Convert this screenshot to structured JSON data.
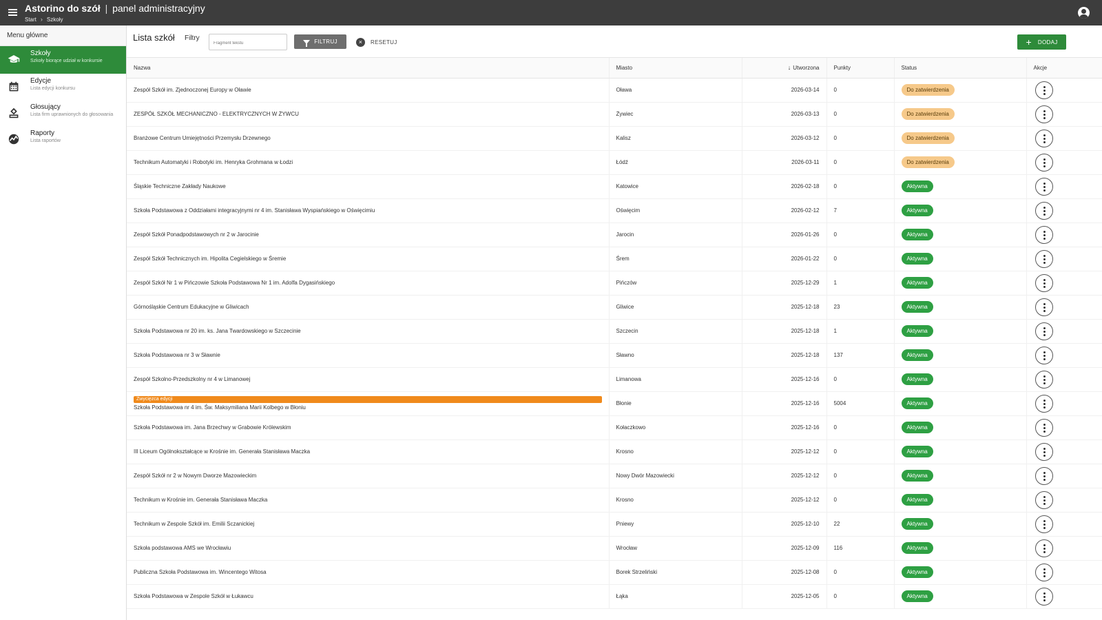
{
  "header": {
    "app_name": "Astorino do szół",
    "separator": "|",
    "app_subtitle": "panel administracyjny",
    "breadcrumb": [
      "Start",
      "Szkoły"
    ],
    "menu_icon": "hamburger-icon",
    "user_icon": "account-circle-icon"
  },
  "sidebar": {
    "title": "Menu główne",
    "items": [
      {
        "label": "Szkoły",
        "sub": "Szkoły biorące udział w konkursie",
        "icon": "school-icon",
        "active": true
      },
      {
        "label": "Edycje",
        "sub": "Lista edycji konkursu",
        "icon": "calendar-icon",
        "active": false
      },
      {
        "label": "Głosujący",
        "sub": "Lista firm uprawnionych do głosowania",
        "icon": "vote-icon",
        "active": false
      },
      {
        "label": "Raporty",
        "sub": "Lista raportów",
        "icon": "report-icon",
        "active": false
      }
    ]
  },
  "toolbar": {
    "title": "Lista szkół",
    "filters_label": "Filtry",
    "search_placeholder": "Fragment tekstu",
    "filter_button": "FILTRUJ",
    "reset_button": "RESETUJ",
    "add_button": "DODAJ"
  },
  "table": {
    "columns": {
      "name": "Nazwa",
      "city": "Miasto",
      "created": "Utworzona",
      "points": "Punkty",
      "status": "Status",
      "actions": "Akcje"
    },
    "sort": {
      "column": "created",
      "direction": "desc"
    },
    "winner_badge": "Zwycięzca edycji",
    "rows": [
      {
        "name": "Zespół Szkół im. Zjednoczonej Europy w Oławie",
        "city": "Oława",
        "created": "2026-03-14",
        "points": "0",
        "status": "Do zatwierdzenia",
        "status_type": "pending"
      },
      {
        "name": "ZESPÓŁ SZKÓŁ MECHANICZNO - ELEKTRYCZNYCH W ŻYWCU",
        "city": "Żywiec",
        "created": "2026-03-13",
        "points": "0",
        "status": "Do zatwierdzenia",
        "status_type": "pending"
      },
      {
        "name": "Branżowe Centrum Umiejętności Przemysłu Drzewnego",
        "city": "Kalisz",
        "created": "2026-03-12",
        "points": "0",
        "status": "Do zatwierdzenia",
        "status_type": "pending"
      },
      {
        "name": "Technikum Automatyki i Robotyki im. Henryka Grohmana w Łodzi",
        "city": "Łódź",
        "created": "2026-03-11",
        "points": "0",
        "status": "Do zatwierdzenia",
        "status_type": "pending"
      },
      {
        "name": "Śląskie Techniczne Zakłady Naukowe",
        "city": "Katowice",
        "created": "2026-02-18",
        "points": "0",
        "status": "Aktywna",
        "status_type": "active"
      },
      {
        "name": "Szkoła Podstawowa z Oddziałami integracyjnymi nr 4 im. Stanisława Wyspiańskiego w Oświęcimiu",
        "city": "Oświęcim",
        "created": "2026-02-12",
        "points": "7",
        "status": "Aktywna",
        "status_type": "active"
      },
      {
        "name": "Zespół Szkół Ponadpodstawowych nr 2 w Jarocinie",
        "city": "Jarocin",
        "created": "2026-01-26",
        "points": "0",
        "status": "Aktywna",
        "status_type": "active"
      },
      {
        "name": "Zespół Szkół Technicznych im. Hipolita Cegielskiego w Śremie",
        "city": "Śrem",
        "created": "2026-01-22",
        "points": "0",
        "status": "Aktywna",
        "status_type": "active"
      },
      {
        "name": "Zespół Szkół Nr 1 w Pińczowie Szkoła Podstawowa Nr 1 im. Adolfa Dygasińskiego",
        "city": "Pińczów",
        "created": "2025-12-29",
        "points": "1",
        "status": "Aktywna",
        "status_type": "active"
      },
      {
        "name": "Górnośląskie Centrum Edukacyjne w Gliwicach",
        "city": "Gliwice",
        "created": "2025-12-18",
        "points": "23",
        "status": "Aktywna",
        "status_type": "active"
      },
      {
        "name": "Szkoła Podstawowa nr 20 im. ks. Jana Twardowskiego w Szczecinie",
        "city": "Szczecin",
        "created": "2025-12-18",
        "points": "1",
        "status": "Aktywna",
        "status_type": "active"
      },
      {
        "name": "Szkoła Podstawowa nr 3 w Sławnie",
        "city": "Sławno",
        "created": "2025-12-18",
        "points": "137",
        "status": "Aktywna",
        "status_type": "active"
      },
      {
        "name": "Zespół Szkolno-Przedszkolny nr 4 w Limanowej",
        "city": "Limanowa",
        "created": "2025-12-16",
        "points": "0",
        "status": "Aktywna",
        "status_type": "active"
      },
      {
        "name": "Szkoła Podstawowa nr 4 im. Św. Maksymiliana Marii Kolbego w Błoniu",
        "city": "Błonie",
        "created": "2025-12-16",
        "points": "5004",
        "status": "Aktywna",
        "status_type": "active",
        "winner": true
      },
      {
        "name": "Szkoła Podstawowa im. Jana Brzechwy w Grabowie Królewskim",
        "city": "Kołaczkowo",
        "created": "2025-12-16",
        "points": "0",
        "status": "Aktywna",
        "status_type": "active"
      },
      {
        "name": "III Liceum Ogólnokształcące w Krośnie im. Generała Stanisława Maczka",
        "city": "Krosno",
        "created": "2025-12-12",
        "points": "0",
        "status": "Aktywna",
        "status_type": "active"
      },
      {
        "name": "Zespół Szkół nr 2 w Nowym Dworze Mazowieckim",
        "city": "Nowy Dwór Mazowiecki",
        "created": "2025-12-12",
        "points": "0",
        "status": "Aktywna",
        "status_type": "active"
      },
      {
        "name": "Technikum w Krośnie im. Generała Stanisława Maczka",
        "city": "Krosno",
        "created": "2025-12-12",
        "points": "0",
        "status": "Aktywna",
        "status_type": "active"
      },
      {
        "name": "Technikum w Zespole Szkół im. Emilii Sczanickiej",
        "city": "Pniewy",
        "created": "2025-12-10",
        "points": "22",
        "status": "Aktywna",
        "status_type": "active"
      },
      {
        "name": "Szkoła podstawowa AMS we Wrocławiu",
        "city": "Wrocław",
        "created": "2025-12-09",
        "points": "116",
        "status": "Aktywna",
        "status_type": "active"
      },
      {
        "name": "Publiczna Szkoła Podstawowa im. Wincentego Witosa",
        "city": "Borek Strzeliński",
        "created": "2025-12-08",
        "points": "0",
        "status": "Aktywna",
        "status_type": "active"
      },
      {
        "name": "Szkoła Podstawowa w Zespole Szkół w Łukawcu",
        "city": "Łąka",
        "created": "2025-12-05",
        "points": "0",
        "status": "Aktywna",
        "status_type": "active"
      }
    ]
  },
  "colors": {
    "topbar": "#3d3d3d",
    "primary": "#2e8b3a",
    "active_badge": "#2ea043",
    "pending_badge": "#f6c98a",
    "winner_badge": "#f08a1c"
  }
}
